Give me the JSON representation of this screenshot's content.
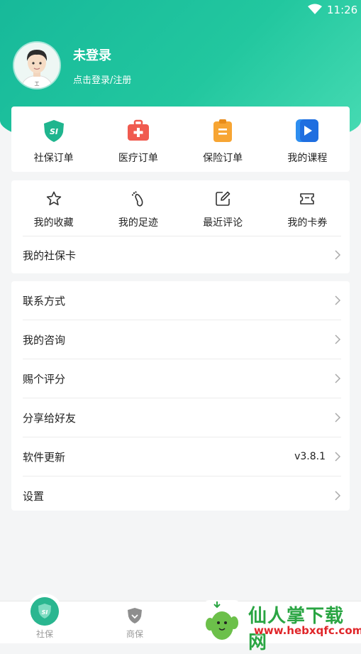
{
  "status_bar": {
    "time": "11:26"
  },
  "profile": {
    "name": "未登录",
    "subtitle": "点击登录/注册",
    "avatar_tag": "工"
  },
  "orders": [
    {
      "label": "社保订单",
      "icon": "shield-si-icon",
      "badge_text": "SI"
    },
    {
      "label": "医疗订单",
      "icon": "medical-kit-icon"
    },
    {
      "label": "保险订单",
      "icon": "clipboard-icon"
    },
    {
      "label": "我的课程",
      "icon": "play-video-icon"
    }
  ],
  "quick_actions": [
    {
      "label": "我的收藏",
      "icon": "star-icon"
    },
    {
      "label": "我的足迹",
      "icon": "footprint-icon"
    },
    {
      "label": "最近评论",
      "icon": "edit-comment-icon"
    },
    {
      "label": "我的卡券",
      "icon": "ticket-icon"
    }
  ],
  "social_card_row": {
    "label": "我的社保卡"
  },
  "menu": [
    {
      "label": "联系方式",
      "value": ""
    },
    {
      "label": "我的咨询",
      "value": ""
    },
    {
      "label": "赐个评分",
      "value": ""
    },
    {
      "label": "分享给好友",
      "value": ""
    },
    {
      "label": "软件更新",
      "value": "v3.8.1"
    },
    {
      "label": "设置",
      "value": ""
    }
  ],
  "tabbar": [
    {
      "label": "社保",
      "badge_text": "SI"
    },
    {
      "label": "商保"
    }
  ],
  "watermark": {
    "title": "仙人掌下载网",
    "url": "www.hebxqfc.com"
  },
  "colors": {
    "brand": "#22c09c",
    "accent_dark": "#2ab690"
  }
}
